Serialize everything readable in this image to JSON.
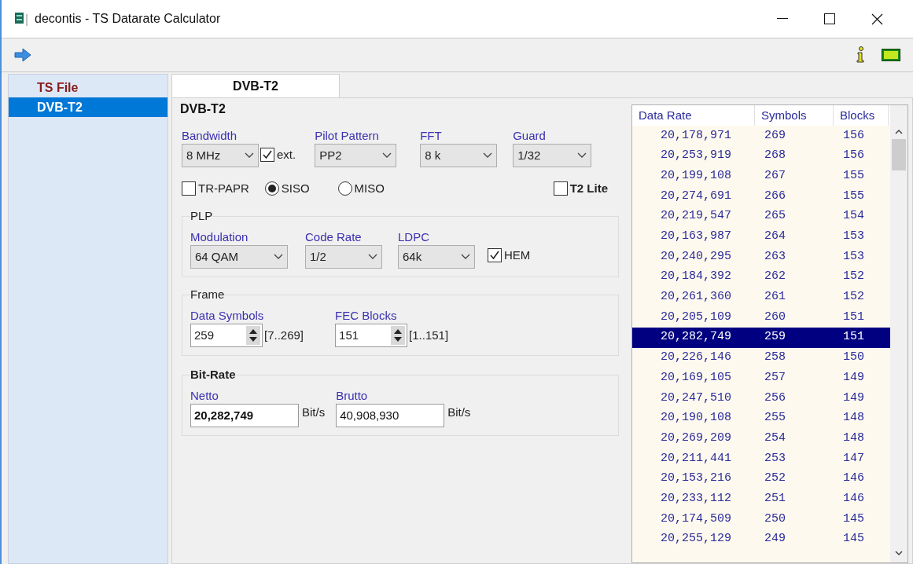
{
  "window": {
    "title": "decontis - TS Datarate Calculator"
  },
  "sidebar": {
    "items": [
      {
        "label": "TS File",
        "selected": false
      },
      {
        "label": "DVB-T2",
        "selected": true
      }
    ]
  },
  "tabs": [
    {
      "label": "DVB-T2",
      "selected": true
    }
  ],
  "main": {
    "title": "DVB-T2",
    "selects": [
      {
        "label": "Bandwidth",
        "value": "8 MHz"
      },
      {
        "label": "Pilot Pattern",
        "value": "PP2"
      },
      {
        "label": "FFT",
        "value": "8 k"
      },
      {
        "label": "Guard",
        "value": "1/32"
      }
    ],
    "ext": {
      "label": "ext.",
      "checked": true
    },
    "tr_papr": {
      "label": "TR-PAPR",
      "checked": false
    },
    "mode": [
      {
        "label": "SISO",
        "selected": true
      },
      {
        "label": "MISO",
        "selected": false
      }
    ],
    "t2_lite": {
      "label": "T2 Lite",
      "checked": false
    },
    "plp": {
      "title": "PLP",
      "selects": [
        {
          "label": "Modulation",
          "value": "64 QAM"
        },
        {
          "label": "Code Rate",
          "value": "1/2"
        },
        {
          "label": "LDPC",
          "value": "64k"
        }
      ],
      "hem": {
        "label": "HEM",
        "checked": true
      }
    },
    "frame": {
      "title": "Frame",
      "spins": [
        {
          "label": "Data Symbols",
          "value": "259",
          "range": "[7..269]"
        },
        {
          "label": "FEC Blocks",
          "value": "151",
          "range": "[1..151]"
        }
      ]
    },
    "bitrate": {
      "title": "Bit-Rate",
      "fields": [
        {
          "label": "Netto",
          "value": "20,282,749",
          "unit": "Bit/s",
          "bold": true
        },
        {
          "label": "Brutto",
          "value": "40,908,930",
          "unit": "Bit/s",
          "bold": false
        }
      ]
    }
  },
  "table": {
    "columns": [
      "Data Rate",
      "Symbols",
      "Blocks"
    ],
    "rows": [
      {
        "cells": [
          "20,178,971",
          "269",
          "156"
        ],
        "selected": false
      },
      {
        "cells": [
          "20,253,919",
          "268",
          "156"
        ],
        "selected": false
      },
      {
        "cells": [
          "20,199,108",
          "267",
          "155"
        ],
        "selected": false
      },
      {
        "cells": [
          "20,274,691",
          "266",
          "155"
        ],
        "selected": false
      },
      {
        "cells": [
          "20,219,547",
          "265",
          "154"
        ],
        "selected": false
      },
      {
        "cells": [
          "20,163,987",
          "264",
          "153"
        ],
        "selected": false
      },
      {
        "cells": [
          "20,240,295",
          "263",
          "153"
        ],
        "selected": false
      },
      {
        "cells": [
          "20,184,392",
          "262",
          "152"
        ],
        "selected": false
      },
      {
        "cells": [
          "20,261,360",
          "261",
          "152"
        ],
        "selected": false
      },
      {
        "cells": [
          "20,205,109",
          "260",
          "151"
        ],
        "selected": false
      },
      {
        "cells": [
          "20,282,749",
          "259",
          "151"
        ],
        "selected": true
      },
      {
        "cells": [
          "20,226,146",
          "258",
          "150"
        ],
        "selected": false
      },
      {
        "cells": [
          "20,169,105",
          "257",
          "149"
        ],
        "selected": false
      },
      {
        "cells": [
          "20,247,510",
          "256",
          "149"
        ],
        "selected": false
      },
      {
        "cells": [
          "20,190,108",
          "255",
          "148"
        ],
        "selected": false
      },
      {
        "cells": [
          "20,269,209",
          "254",
          "148"
        ],
        "selected": false
      },
      {
        "cells": [
          "20,211,441",
          "253",
          "147"
        ],
        "selected": false
      },
      {
        "cells": [
          "20,153,216",
          "252",
          "146"
        ],
        "selected": false
      },
      {
        "cells": [
          "20,233,112",
          "251",
          "146"
        ],
        "selected": false
      },
      {
        "cells": [
          "20,174,509",
          "250",
          "145"
        ],
        "selected": false
      },
      {
        "cells": [
          "20,255,129",
          "249",
          "145"
        ],
        "selected": false
      }
    ]
  }
}
